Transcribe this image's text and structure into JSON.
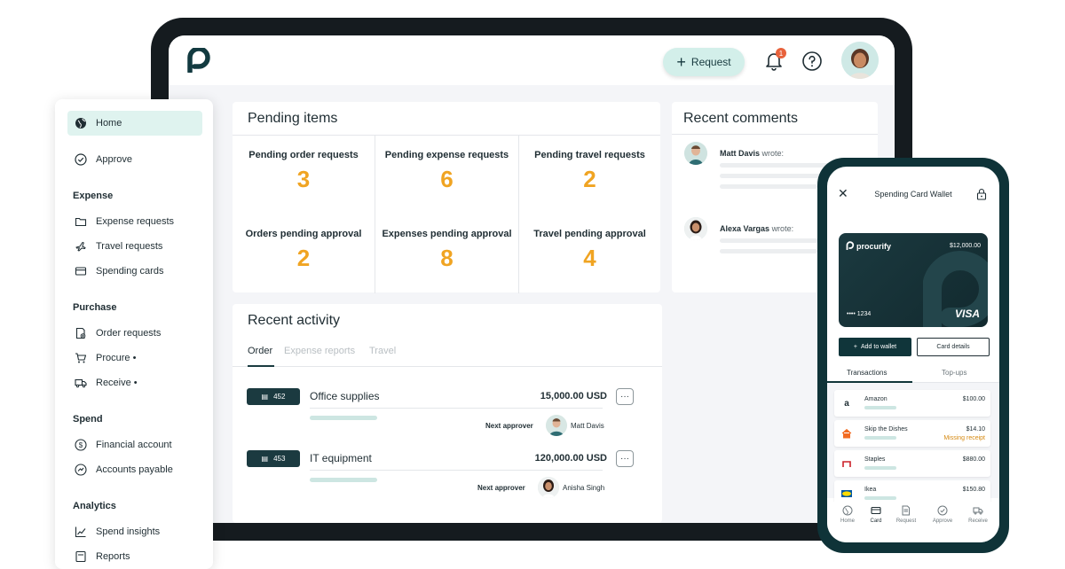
{
  "topbar": {
    "request_label": "Request",
    "notification_count": "1"
  },
  "pending": {
    "title": "Pending items",
    "items": [
      {
        "label": "Pending order requests",
        "value": "3"
      },
      {
        "label": "Pending expense requests",
        "value": "6"
      },
      {
        "label": "Pending travel requests",
        "value": "2"
      },
      {
        "label": "Orders pending approval",
        "value": "2"
      },
      {
        "label": "Expenses pending approval",
        "value": "8"
      },
      {
        "label": "Travel pending approval",
        "value": "4"
      }
    ]
  },
  "comments": {
    "title": "Recent comments",
    "items": [
      {
        "name": "Matt Davis",
        "suffix": "wrote:"
      },
      {
        "name": "Alexa Vargas",
        "suffix": "wrote:"
      }
    ]
  },
  "activity": {
    "title": "Recent activity",
    "tabs": [
      "Order",
      "Expense reports",
      "Travel"
    ],
    "rows": [
      {
        "id": "452",
        "name": "Office supplies",
        "amount": "15,000.00 USD",
        "next_label": "Next approver",
        "approver": "Matt Davis"
      },
      {
        "id": "453",
        "name": "IT equipment",
        "amount": "120,000.00 USD",
        "next_label": "Next approver",
        "approver": "Anisha Singh"
      }
    ],
    "menu_glyph": "···"
  },
  "sidebar": {
    "home": "Home",
    "approve": "Approve",
    "sections": {
      "expense": "Expense",
      "purchase": "Purchase",
      "spend": "Spend",
      "analytics": "Analytics"
    },
    "items": {
      "expense_requests": "Expense requests",
      "travel_requests": "Travel requests",
      "spending_cards": "Spending cards",
      "order_requests": "Order requests",
      "procure": "Procure •",
      "receive": "Receive •",
      "financial_account": "Financial account",
      "accounts_payable": "Accounts payable",
      "spend_insights": "Spend insights",
      "reports": "Reports"
    }
  },
  "phone": {
    "title": "Spending Card Wallet",
    "card": {
      "brand": "procurify",
      "amount": "$12,000.00",
      "number": "•••• 1234",
      "network": "VISA"
    },
    "add_to_wallet": "Add to wallet",
    "card_details": "Card details",
    "tabs": [
      "Transactions",
      "Top-ups"
    ],
    "transactions": [
      {
        "name": "Amazon",
        "amount": "$100.00",
        "icon": "a",
        "note": ""
      },
      {
        "name": "Skip the Dishes",
        "amount": "$14.10",
        "icon": "skip-icon",
        "note": "Missing receipt"
      },
      {
        "name": "Staples",
        "amount": "$880.00",
        "icon": "staples-icon",
        "note": ""
      },
      {
        "name": "Ikea",
        "amount": "$150.80",
        "icon": "ikea-icon",
        "note": ""
      }
    ],
    "nav": [
      "Home",
      "Card",
      "Request",
      "Approve",
      "Receive"
    ]
  }
}
